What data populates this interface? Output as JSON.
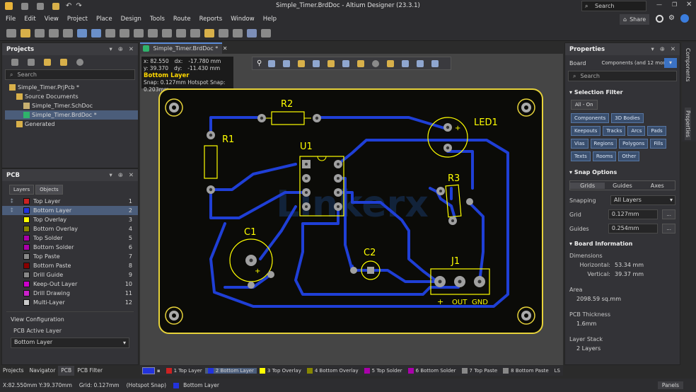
{
  "app": {
    "title": "Simple_Timer.BrdDoc - Altium Designer (23.3.1)",
    "search": "Search",
    "share": "Share"
  },
  "menu": [
    "File",
    "Edit",
    "View",
    "Project",
    "Place",
    "Design",
    "Tools",
    "Route",
    "Reports",
    "Window",
    "Help"
  ],
  "projects": {
    "title": "Projects",
    "search": "Search",
    "tree": [
      {
        "label": "Simple_Timer.PrjPcb *",
        "level": 0
      },
      {
        "label": "Source Documents",
        "level": 1
      },
      {
        "label": "Simple_Timer.SchDoc",
        "level": 2
      },
      {
        "label": "Simple_Timer.BrdDoc *",
        "level": 2,
        "selected": true
      },
      {
        "label": "Generated",
        "level": 1
      }
    ]
  },
  "pcb_panel": {
    "title": "PCB",
    "tabs": [
      "Layers",
      "Objects"
    ],
    "layers": [
      {
        "name": "Top Layer",
        "num": "1",
        "color": "#cc2222"
      },
      {
        "name": "Bottom Layer",
        "num": "2",
        "color": "#2233dd",
        "selected": true
      },
      {
        "name": "Top Overlay",
        "num": "3",
        "color": "#ffff00"
      },
      {
        "name": "Bottom Overlay",
        "num": "4",
        "color": "#888800"
      },
      {
        "name": "Top Solder",
        "num": "5",
        "color": "#aa00aa"
      },
      {
        "name": "Bottom Solder",
        "num": "6",
        "color": "#aa00aa"
      },
      {
        "name": "Top Paste",
        "num": "7",
        "color": "#888888"
      },
      {
        "name": "Bottom Paste",
        "num": "8",
        "color": "#880000"
      },
      {
        "name": "Drill Guide",
        "num": "9",
        "color": "#888888"
      },
      {
        "name": "Keep-Out Layer",
        "num": "10",
        "color": "#cc00cc"
      },
      {
        "name": "Drill Drawing",
        "num": "11",
        "color": "#cc22cc"
      },
      {
        "name": "Multi-Layer",
        "num": "12",
        "color": "#cccccc"
      }
    ],
    "view_config": "View Configuration",
    "active_layer_label": "PCB Active Layer",
    "active_layer": "Bottom Layer"
  },
  "bottom_tabs": [
    "Projects",
    "Navigator",
    "PCB",
    "PCB Filter"
  ],
  "doc_tab": "Simple_Timer.BrdDoc *",
  "hud": {
    "x": "x: 82.550",
    "dx": "dx:",
    "dxv": "-17.780 mm",
    "y": "y: 39.370",
    "dy": "dy:",
    "dyv": "-11.430 mm",
    "layer": "Bottom Layer",
    "snap": "Snap: 0.127mm Hotspot Snap: 0.203mm"
  },
  "board": {
    "labels": {
      "r1": "R1",
      "r2": "R2",
      "r3": "R3",
      "u1": "U1",
      "c1": "C1",
      "c2": "C2",
      "j1": "J1",
      "led1": "LED1",
      "plus": "+",
      "out": "OUT",
      "gnd": "GND",
      "watermark": "Linkerx"
    }
  },
  "properties": {
    "title": "Properties",
    "board_label": "Board",
    "board_value": "Components (and 12 more)",
    "search": "Search",
    "selection_filter": "Selection Filter",
    "all_on": "All - On",
    "filters": [
      "Components",
      "3D Bodies",
      "Keepouts",
      "Tracks",
      "Arcs",
      "Pads",
      "Vias",
      "Regions",
      "Polygons",
      "Fills",
      "Texts",
      "Rooms",
      "Other"
    ],
    "snap_options": "Snap Options",
    "snap_tabs": [
      "Grids",
      "Guides",
      "Axes"
    ],
    "snapping_label": "Snapping",
    "snapping_value": "All Layers",
    "grid_label": "Grid",
    "grid_value": "0.127mm",
    "guides_label": "Guides",
    "guides_value": "0.254mm",
    "board_info": "Board Information",
    "dimensions": "Dimensions",
    "horizontal_label": "Horizontal:",
    "horizontal": "53.34 mm",
    "vertical_label": "Vertical:",
    "vertical": "39.37 mm",
    "area_label": "Area",
    "area": "2098.59 sq.mm",
    "thickness_label": "PCB Thickness",
    "thickness": "1.6mm",
    "stack_label": "Layer Stack",
    "stack": "2 Layers"
  },
  "side_tabs": [
    "Components",
    "Properties"
  ],
  "layer_tabs": [
    {
      "label": "1 Top Layer",
      "color": "#cc2222"
    },
    {
      "label": "2 Bottom Layer",
      "color": "#2233dd",
      "active": true
    },
    {
      "label": "3 Top Overlay",
      "color": "#ffff00"
    },
    {
      "label": "4 Bottom Overlay",
      "color": "#888800"
    },
    {
      "label": "5 Top Solder",
      "color": "#aa00aa"
    },
    {
      "label": "6 Bottom Solder",
      "color": "#aa00aa"
    },
    {
      "label": "7 Top Paste",
      "color": "#888888"
    },
    {
      "label": "8 Bottom Paste",
      "color": "#888888"
    },
    {
      "label": "LS",
      "color": ""
    }
  ],
  "status": {
    "coords": "X:82.550mm Y:39.370mm",
    "grid": "Grid: 0.127mm",
    "snap": "(Hotspot Snap)",
    "layer": "Bottom Layer",
    "panels": "Panels"
  }
}
